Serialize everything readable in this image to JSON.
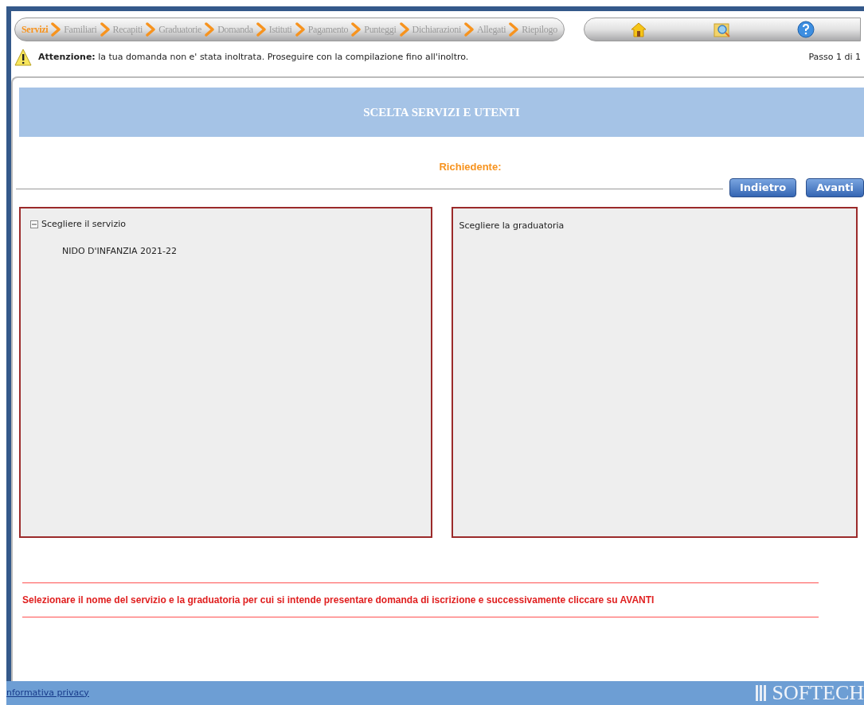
{
  "steps": [
    {
      "label": "Servizi",
      "selected": true
    },
    {
      "label": "Familiari",
      "selected": false
    },
    {
      "label": "Recapiti",
      "selected": false
    },
    {
      "label": "Graduatorie",
      "selected": false
    },
    {
      "label": "Domanda",
      "selected": false
    },
    {
      "label": "Istituti",
      "selected": false
    },
    {
      "label": "Pagamento",
      "selected": false
    },
    {
      "label": "Punteggi",
      "selected": false
    },
    {
      "label": "Dichiarazioni",
      "selected": false
    },
    {
      "label": "Allegati",
      "selected": false
    },
    {
      "label": "Riepilogo",
      "selected": false
    }
  ],
  "warning": {
    "label": "Attenzione:",
    "text": "la tua domanda non e' stata inoltrata. Proseguire con la compilazione fino all'inoltro.",
    "step": "Passo 1 di 1"
  },
  "section_title": "SCELTA SERVIZI E UTENTI",
  "requester_label": "Richiedente:",
  "buttons": [
    "Indietro",
    "Avanti"
  ],
  "services": {
    "title": "Scegliere il servizio",
    "expanded": true,
    "children": [
      {
        "label": "NIDO D'INFANZIA 2021-22"
      }
    ]
  },
  "rankings": {
    "title": "Scegliere la graduatoria"
  },
  "instruction": "Selezionare il nome del servizio e la graduatoria per cui si intende presentare domanda di iscrizione e successivamente cliccare su AVANTI",
  "footer": {
    "link": "nformativa privacy",
    "brand": "SOFTECH"
  }
}
